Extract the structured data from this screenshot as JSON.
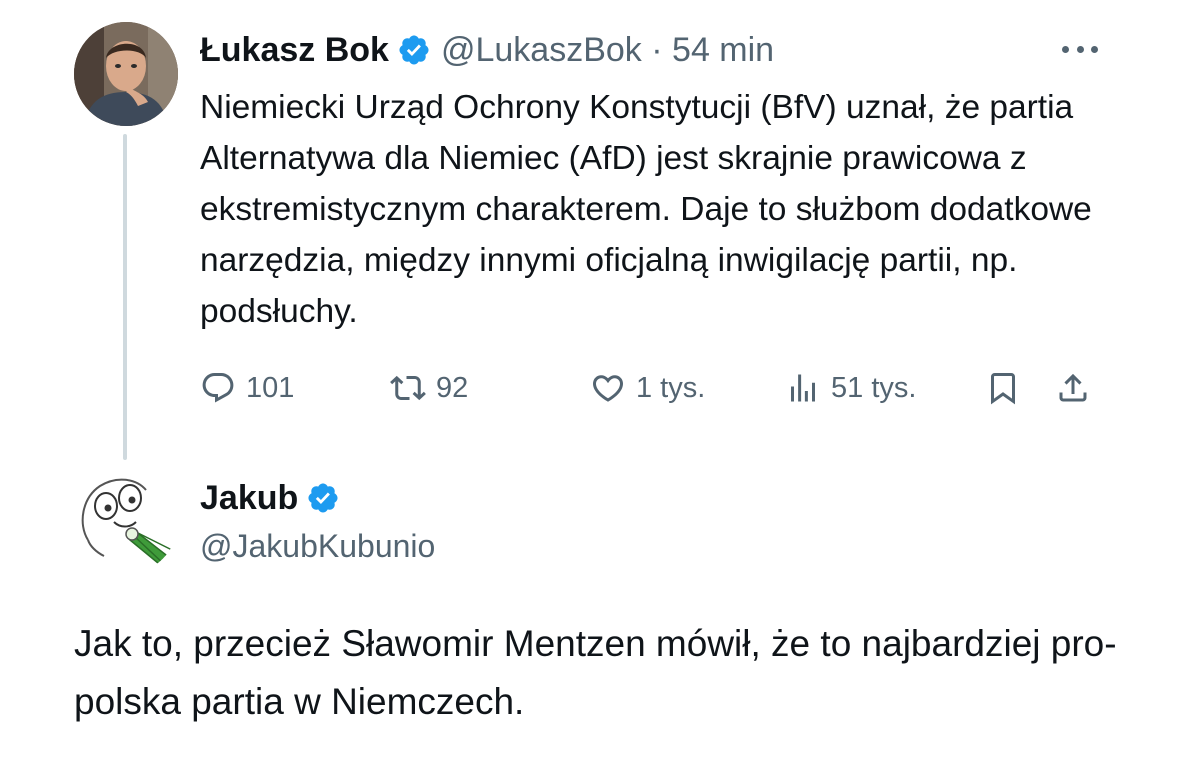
{
  "tweet": {
    "author_name": "Łukasz Bok",
    "author_handle": "@LukaszBok",
    "separator": "·",
    "time": "54 min",
    "text": "Niemiecki Urząd Ochrony Konstytucji (BfV) uznał, że partia Alternatywa dla Niemiec (AfD) jest skrajnie prawicowa z ekstremistycznym charakterem. Daje to służbom dodatkowe narzędzia, między innymi oficjalną inwigilację partii, np. podsłuchy.",
    "metrics": {
      "replies": "101",
      "retweets": "92",
      "likes": "1 tys.",
      "views": "51 tys."
    }
  },
  "reply": {
    "author_name": "Jakub",
    "author_handle": "@JakubKubunio",
    "text": "Jak to, przecież Sławomir Mentzen mówił, że to najbardziej pro-polska partia w Niemczech."
  },
  "icons": {
    "verified": "verified-badge-icon",
    "more": "more-dots-icon",
    "reply": "reply-icon",
    "retweet": "retweet-icon",
    "like": "heart-icon",
    "views": "views-chart-icon",
    "bookmark": "bookmark-icon",
    "share": "share-icon"
  },
  "colors": {
    "verified_blue": "#1d9bf0",
    "secondary_text": "#536471",
    "primary_text": "#0f1419",
    "thread_line": "#cfd9de"
  }
}
